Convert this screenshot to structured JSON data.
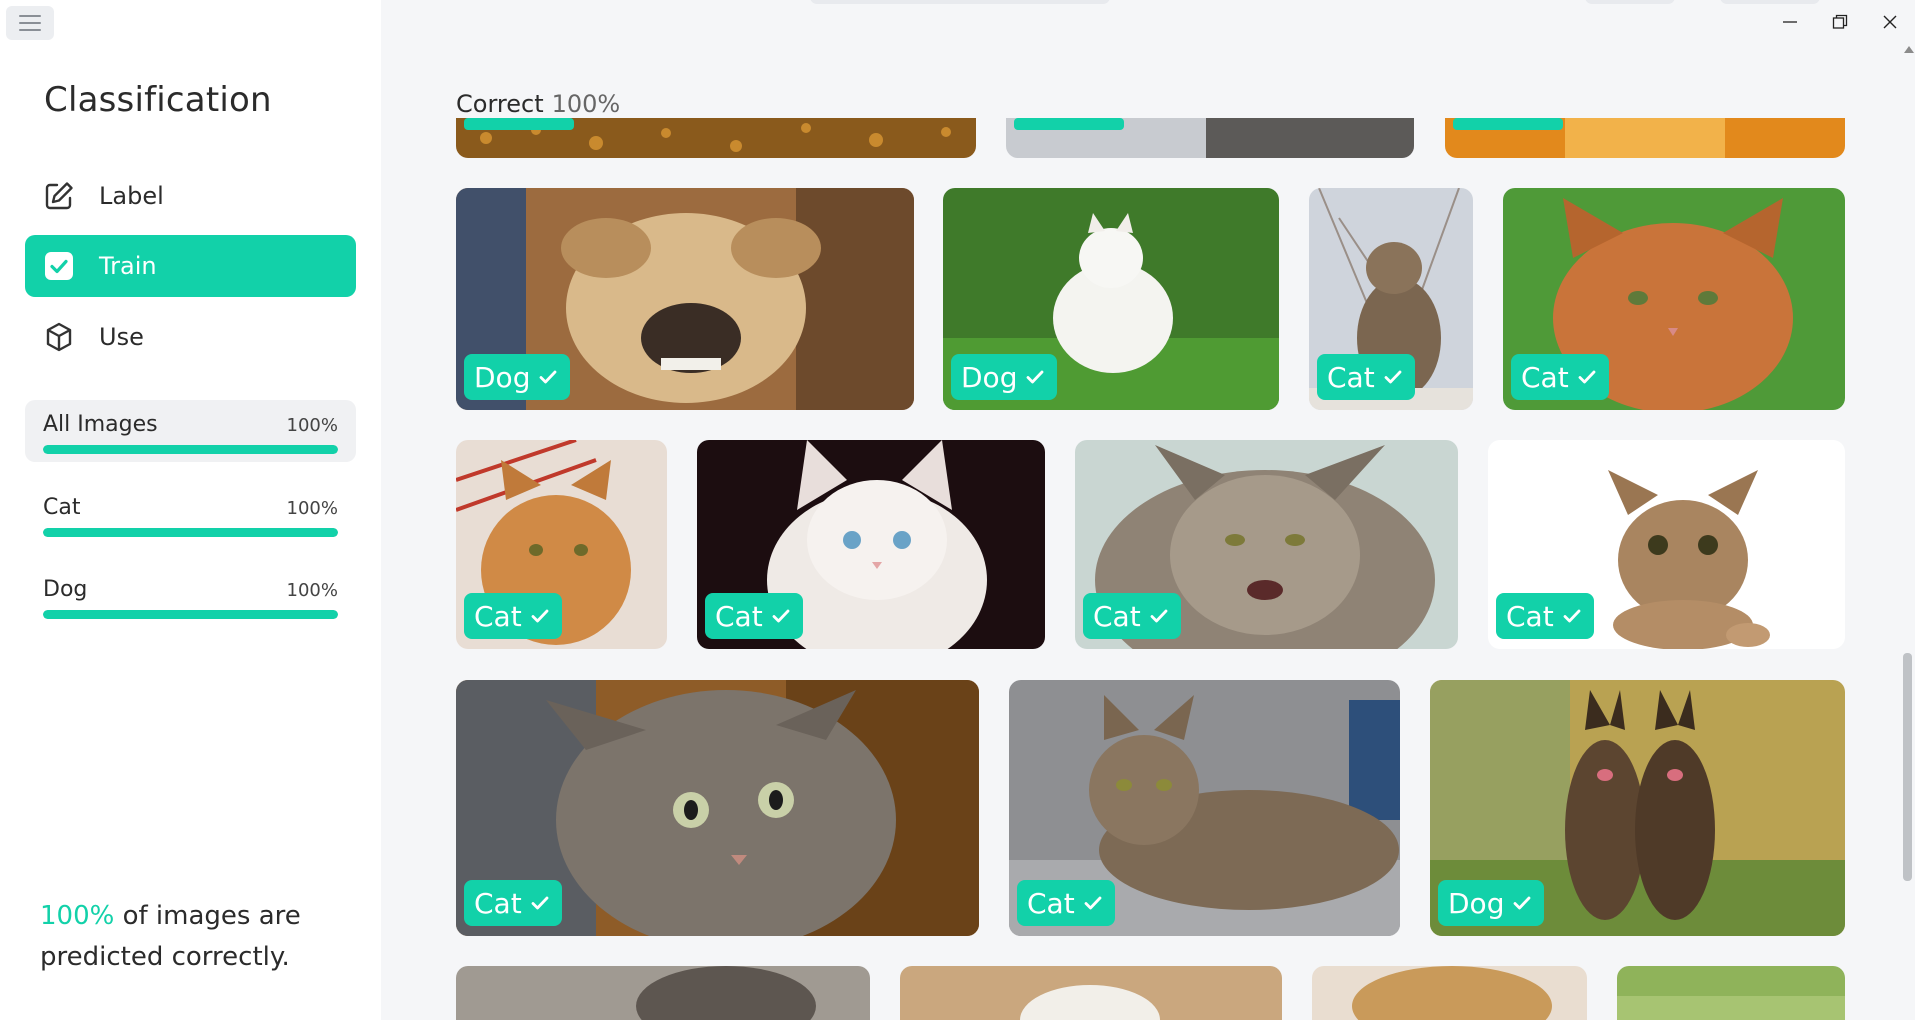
{
  "sidebar": {
    "title": "Classification",
    "nav": [
      {
        "label": "Label",
        "icon": "edit-icon",
        "active": false
      },
      {
        "label": "Train",
        "icon": "checkbox-icon",
        "active": true
      },
      {
        "label": "Use",
        "icon": "cube-icon",
        "active": false
      }
    ],
    "stats": [
      {
        "name": "All Images",
        "percent": "100%",
        "progress": 1.0
      },
      {
        "name": "Cat",
        "percent": "100%",
        "progress": 1.0
      },
      {
        "name": "Dog",
        "percent": "100%",
        "progress": 1.0
      }
    ],
    "summary": {
      "accent": "100%",
      "rest": "of images are predicted correctly."
    }
  },
  "main": {
    "header_label": "Correct",
    "header_pct": "100%",
    "images": [
      {
        "label": "Dog",
        "subject": "small tan dog snarling",
        "correct": true
      },
      {
        "label": "Dog",
        "subject": "white terrier on grass",
        "correct": true
      },
      {
        "label": "Cat",
        "subject": "tabby cat sitting",
        "correct": true
      },
      {
        "label": "Cat",
        "subject": "orange cat on green",
        "correct": true
      },
      {
        "label": "Cat",
        "subject": "orange cat",
        "correct": true
      },
      {
        "label": "Cat",
        "subject": "white kitten on dark",
        "correct": true
      },
      {
        "label": "Cat",
        "subject": "long-haired grumpy cat",
        "correct": true
      },
      {
        "label": "Cat",
        "subject": "tabby cat on white",
        "correct": true
      },
      {
        "label": "Cat",
        "subject": "tabby kitten close-up",
        "correct": true
      },
      {
        "label": "Cat",
        "subject": "tabby cat lying on sofa",
        "correct": true
      },
      {
        "label": "Dog",
        "subject": "two shepherd dogs",
        "correct": true
      }
    ]
  },
  "colors": {
    "accent": "#12d1a9",
    "background": "#f5f6f8",
    "sidebar": "#ffffff"
  }
}
